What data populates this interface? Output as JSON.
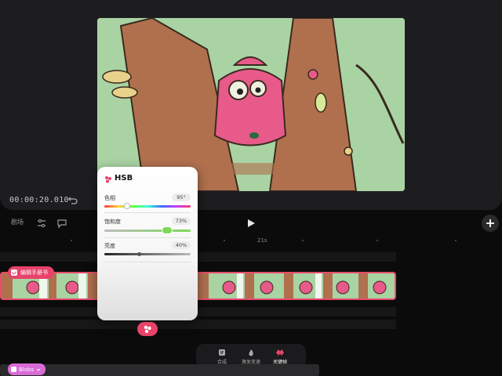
{
  "timeline": {
    "timecode": "00:00:20.010",
    "toolbar_label": "剧场",
    "ruler_label": "21s"
  },
  "hsb_panel": {
    "title": "HSB",
    "hue": {
      "label": "色相",
      "value": "95°",
      "level": 0.26
    },
    "saturation": {
      "label": "饱和度",
      "value": "73%",
      "level": 0.73
    },
    "brightness": {
      "label": "亮度",
      "value": "40%",
      "level": 0.4
    }
  },
  "clip_tag": {
    "label": "编辑手册书"
  },
  "bottom_tabs": [
    {
      "label": "合成",
      "icon": "compose-icon"
    },
    {
      "label": "激发变速",
      "icon": "flame-icon"
    },
    {
      "label": "关键帧",
      "icon": "keyframe-icon"
    }
  ],
  "blobs_tag": {
    "label": "Blobs"
  },
  "colors": {
    "accent": "#e8436a",
    "canvas_bg": "#a9d3a3",
    "tree_brown": "#b0704e",
    "character_pink": "#e85a8a"
  }
}
